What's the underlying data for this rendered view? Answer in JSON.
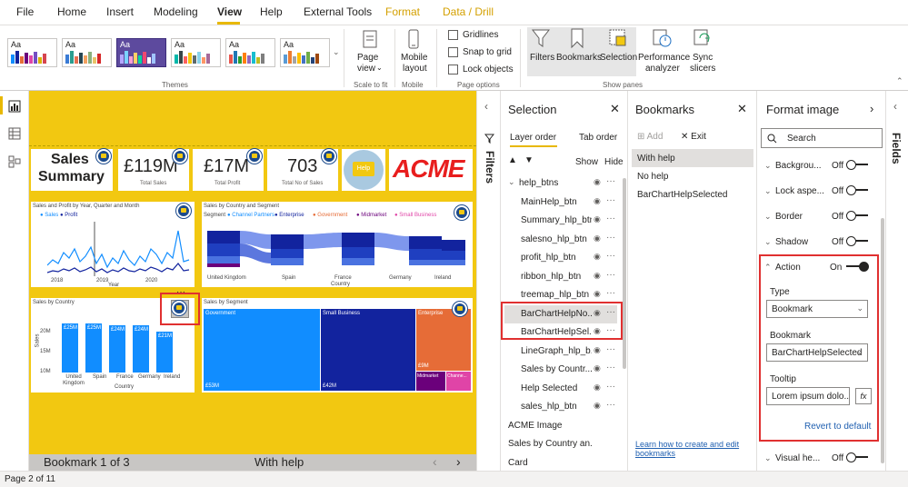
{
  "menu": {
    "file": "File",
    "home": "Home",
    "insert": "Insert",
    "modeling": "Modeling",
    "view": "View",
    "help": "Help",
    "external_tools": "External Tools",
    "format": "Format",
    "data_drill": "Data / Drill"
  },
  "ribbon": {
    "theme_thumb_label": "Aa",
    "themes_label": "Themes",
    "page_view": "Page view",
    "page_view_l1": "Page",
    "page_view_l2": "view",
    "scale_to_fit": "Scale to fit",
    "mobile_layout_l1": "Mobile",
    "mobile_layout_l2": "layout",
    "mobile_group": "Mobile",
    "gridlines": "Gridlines",
    "snap_to_grid": "Snap to grid",
    "lock_objects": "Lock objects",
    "page_options": "Page options",
    "filters": "Filters",
    "bookmarks": "Bookmarks",
    "selection": "Selection",
    "performance_l1": "Performance",
    "performance_l2": "analyzer",
    "sync_l1": "Sync",
    "sync_l2": "slicers",
    "show_panes": "Show panes"
  },
  "canvas": {
    "title_l1": "Sales",
    "title_l2": "Summary",
    "kpis": [
      {
        "value": "£119M",
        "label": "Total Sales"
      },
      {
        "value": "£17M",
        "label": "Total Profit"
      },
      {
        "value": "703",
        "label": "Total No of Sales"
      }
    ],
    "help_image_text": "Help",
    "logo_text": "ACME",
    "line_chart_title": "Sales and Profit by Year, Quarter and Month",
    "line_legend": [
      "Sales",
      "Profit"
    ],
    "line_years": [
      "2018",
      "2019",
      "2020"
    ],
    "line_axis_label": "Year",
    "ribbon_chart_title": "Sales by Country and Segment",
    "ribbon_legend_title": "Segment",
    "ribbon_legend": [
      "Channel Partners",
      "Enterprise",
      "Government",
      "Midmarket",
      "Small Business"
    ],
    "ribbon_countries": [
      "United Kingdom",
      "Spain",
      "France",
      "Germany",
      "Ireland"
    ],
    "ribbon_axis_label": "Country",
    "bar_chart_title": "Sales by Country",
    "bar_labels": [
      "£25M",
      "£25M",
      "£24M",
      "£24M",
      "£21M"
    ],
    "bar_values": [
      25,
      25,
      24,
      24,
      21
    ],
    "bar_countries": [
      "United Kingdom",
      "Spain",
      "France",
      "Germany",
      "Ireland"
    ],
    "bar_y_ticks": [
      "20M",
      "15M",
      "10M"
    ],
    "bar_axis_label": "Country",
    "bar_y_label": "Sales",
    "treemap_title": "Sales by Segment",
    "treemap": {
      "government": "Government",
      "government_val": "£53M",
      "small_business": "Small Business",
      "small_business_val": "£42M",
      "enterprise": "Enterprise",
      "enterprise_val": "£9M",
      "midmarket": "Midmarket",
      "channel": "Channe..."
    }
  },
  "bookmark_bar": {
    "counter": "Bookmark 1 of 3",
    "name": "With help"
  },
  "status": {
    "page": "Page 2 of 11"
  },
  "filters_label": "Filters",
  "selection": {
    "title": "Selection",
    "tab_layer_order": "Layer order",
    "tab_order": "Tab order",
    "show": "Show",
    "hide": "Hide",
    "layers": [
      "help_btns",
      "MainHelp_btn",
      "Summary_hlp_btn",
      "salesno_hlp_btn",
      "profit_hlp_btn",
      "ribbon_hlp_btn",
      "treemap_hlp_btn",
      "BarChartHelpNo...",
      "BarChartHelpSel...",
      "LineGraph_hlp_b...",
      "Sales by Countr...",
      "Help Selected",
      "sales_hlp_btn",
      "ACME Image",
      "Sales by Country an...",
      "Card"
    ]
  },
  "bookmarks": {
    "title": "Bookmarks",
    "add": "Add",
    "exit": "Exit",
    "items": [
      "With help",
      "No help",
      "BarChartHelpSelected"
    ],
    "learn_l1": "Learn how to create and edit",
    "learn_l2": "bookmarks"
  },
  "format": {
    "title": "Format image",
    "search_placeholder": "Search",
    "fields_label": "Fields",
    "rows": [
      {
        "name": "Backgrou...",
        "state": "Off"
      },
      {
        "name": "Lock aspe...",
        "state": "Off"
      },
      {
        "name": "Border",
        "state": "Off"
      },
      {
        "name": "Shadow",
        "state": "Off"
      }
    ],
    "action": {
      "name": "Action",
      "state": "On"
    },
    "type_label": "Type",
    "type_value": "Bookmark",
    "bookmark_label": "Bookmark",
    "bookmark_value": "BarChartHelpSelected",
    "tooltip_label": "Tooltip",
    "tooltip_value": "Lorem ipsum dolo...",
    "fx": "fx",
    "revert": "Revert to default",
    "visual_header": {
      "name": "Visual he...",
      "state": "Off"
    }
  },
  "colors": {
    "canvas_yellow": "#f2c811",
    "accent_yellow": "#e8b800",
    "highlight_red": "#e03030",
    "bar_blue": "#118dff",
    "navy": "#12239e"
  }
}
